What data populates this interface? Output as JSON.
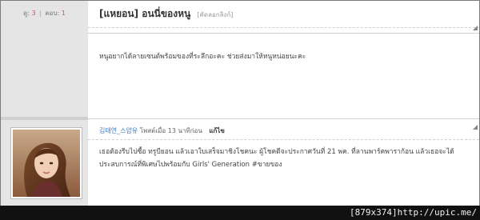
{
  "sidebar": {
    "stats": {
      "likes_label": "ดู",
      "likes_value": "3",
      "comments_label": "ตอบ",
      "comments_value": "1"
    }
  },
  "thread": {
    "title": "[แหยอน] อนนี่ของหนู",
    "copy_link": "[คัดลอกลิงก์]",
    "body": "หนูอยากได้ลายเซนต์พร้อมของที่ระลึกอะคะ ช่วยส่งมาให้หนูหน่อยนะคะ"
  },
  "reply": {
    "author": "김태연_스얍유",
    "posted": "โพสต์เมื่อ 13 นาทีก่อน",
    "edit_label": "แก้ไข",
    "body_line1": "เธอต้องรีบไปซื้อ ทรูบียอน แล้วเอาใบเสร็จมาชิงโชคนะ ผู้โชคดีจะประกาศวันที่ 21 พค. ที่ลานพาร์คพาราก้อน แล้วเธอจะได้",
    "body_line2": "ประสบการณ์ที่พิเศษไปพร้อมกับ Girls' Generation #ขายของ"
  },
  "watermark": "[879x374]http://upic.me/",
  "icons": {
    "avatar": "user-avatar-photo",
    "corner_tick": "corner-arrow-icon"
  }
}
